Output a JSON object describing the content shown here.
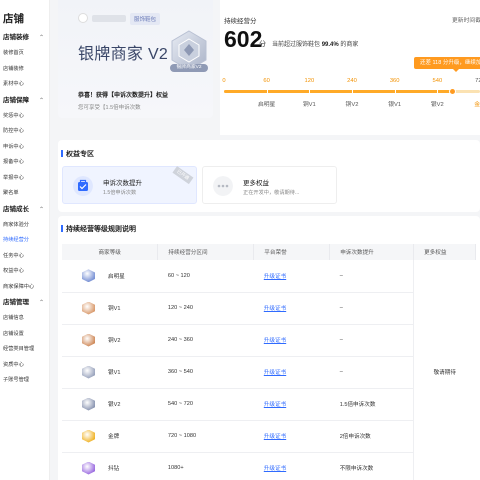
{
  "sidebar": {
    "title": "店铺",
    "groups": [
      {
        "label": "店铺装修",
        "items": [
          "装修首页",
          "店铺装修",
          "素材中心"
        ]
      },
      {
        "label": "店铺保障",
        "items": [
          "奖惩中心",
          "防控中心",
          "申诉中心",
          "报备中心",
          "举报中心",
          "聚名单"
        ]
      },
      {
        "label": "店铺成长",
        "items": [
          "商家体验分",
          "持续经营分",
          "任务中心",
          "权益中心",
          "商家保障中心"
        ]
      },
      {
        "label": "店铺管理",
        "items": [
          "店铺信息",
          "店铺设置",
          "经营类目管理",
          "资质中心",
          "子账号管理"
        ]
      }
    ],
    "active_item": "持续经营分"
  },
  "shop": {
    "tag": "服饰鞋包",
    "level_title": "银牌商家 V2",
    "badge_text": "银牌商家V2",
    "congrats": "恭喜！获得【申诉次数提升】权益",
    "congrats_sub": "您可享受【1.5倍申诉次数"
  },
  "score": {
    "label": "持续经营分",
    "updated": "更新时间截至：20",
    "value": "602",
    "unit": "分",
    "desc_prefix": "当前超过服饰鞋包",
    "desc_percent": "99.4%",
    "desc_suffix": "的商家",
    "upgrade_tip": "还差 118 分升级，继续加油哦",
    "current": 602,
    "ticks": [
      "0",
      "60",
      "120",
      "240",
      "360",
      "540",
      "720"
    ],
    "tick_values": [
      0,
      60,
      120,
      240,
      360,
      540,
      720
    ],
    "level_names": [
      "启明星",
      "铜V1",
      "铜V2",
      "银V1",
      "银V2",
      "金牌"
    ]
  },
  "benefits": {
    "title": "权益专区",
    "items": [
      {
        "title": "申诉次数提升",
        "sub": "1.5倍申诉次数",
        "corner": "已开通"
      },
      {
        "title": "更多权益",
        "sub": "正在开发中，敬请期待..."
      }
    ]
  },
  "rules": {
    "title": "持续经营等级规则说明",
    "headers": [
      "商家等级",
      "持续经营分区间",
      "平台荣誉",
      "申诉次数提升",
      "更多权益"
    ],
    "rows": [
      {
        "level": "启明星",
        "range": "60 ~ 120",
        "honor": "升级证书",
        "appeal": "–",
        "color": "#7d95d6"
      },
      {
        "level": "铜V1",
        "range": "120 ~ 240",
        "honor": "升级证书",
        "appeal": "–",
        "color": "#d99a6c"
      },
      {
        "level": "铜V2",
        "range": "240 ~ 360",
        "honor": "升级证书",
        "appeal": "–",
        "color": "#cf8a5a"
      },
      {
        "level": "银V1",
        "range": "360 ~ 540",
        "honor": "升级证书",
        "appeal": "–",
        "color": "#9aa4bd"
      },
      {
        "level": "银V2",
        "range": "540 ~ 720",
        "honor": "升级证书",
        "appeal": "1.5倍申诉次数",
        "color": "#8b96b2"
      },
      {
        "level": "金牌",
        "range": "720 ~ 1080",
        "honor": "升级证书",
        "appeal": "2倍申诉次数",
        "color": "#f0b429"
      },
      {
        "level": "抖钻",
        "range": "1080+",
        "honor": "升级证书",
        "appeal": "不限申诉次数",
        "color": "#9b6ce0"
      }
    ],
    "more_benefit": "敬请期待"
  },
  "colors": {
    "accent": "#2f6bff",
    "progress": "#ffaa28",
    "upgrade_bubble": "#ff9a1f"
  }
}
